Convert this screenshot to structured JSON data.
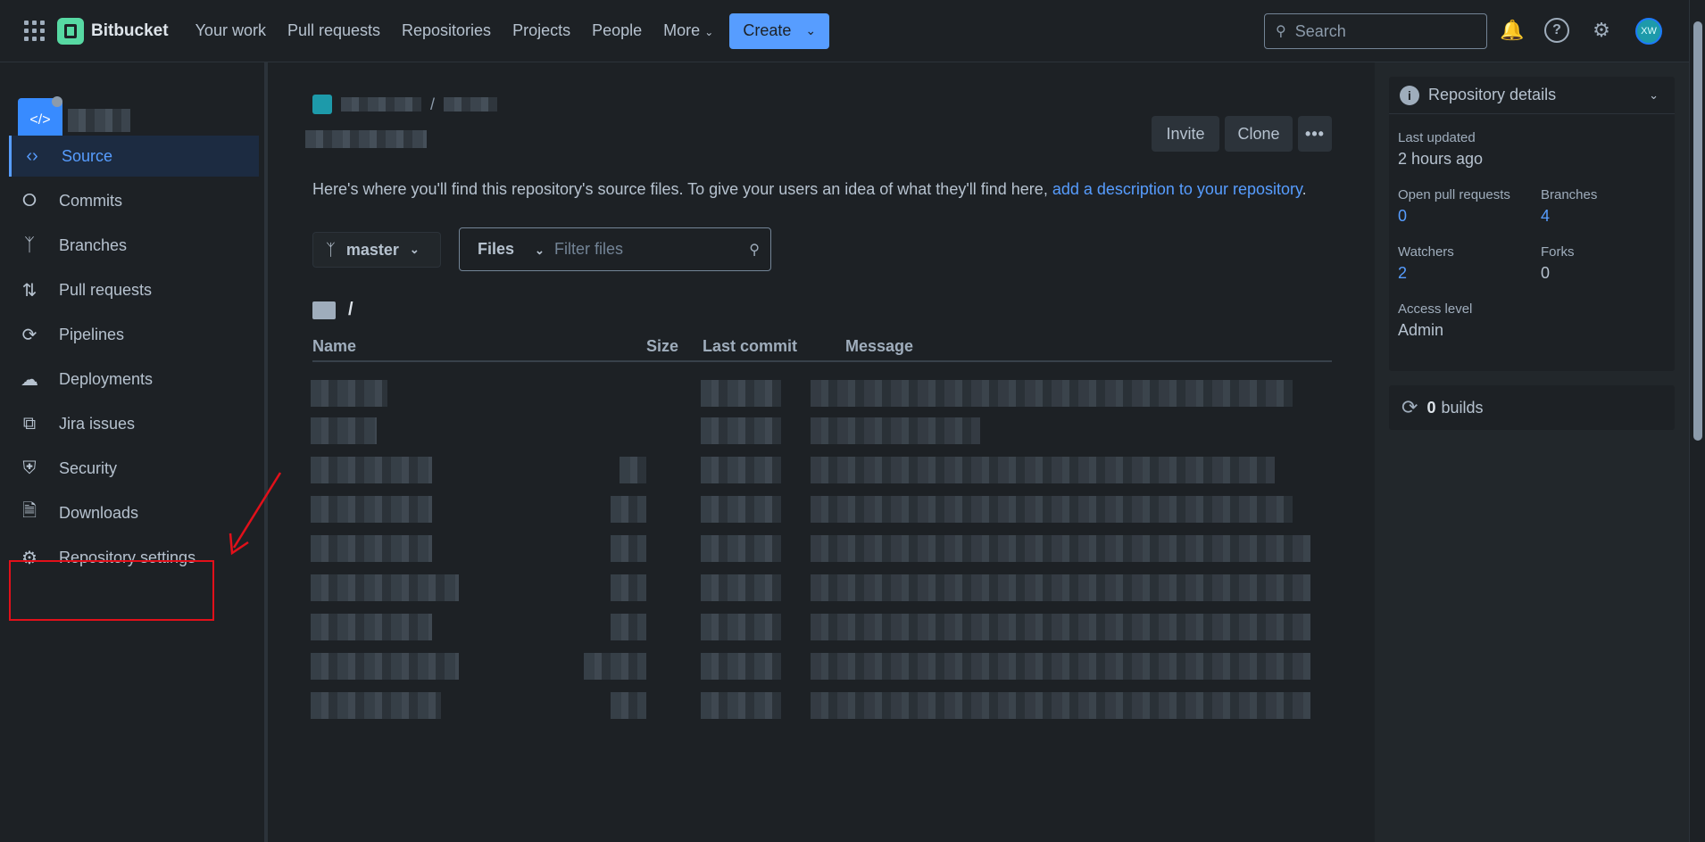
{
  "topbar": {
    "brand": "Bitbucket",
    "nav": [
      "Your work",
      "Pull requests",
      "Repositories",
      "Projects",
      "People",
      "More"
    ],
    "create_label": "Create",
    "search_placeholder": "Search",
    "avatar_initials": "XW"
  },
  "sidebar": {
    "items": [
      {
        "label": "Source",
        "icon": "code-icon"
      },
      {
        "label": "Commits",
        "icon": "commit-icon"
      },
      {
        "label": "Branches",
        "icon": "branch-icon"
      },
      {
        "label": "Pull requests",
        "icon": "pull-request-icon"
      },
      {
        "label": "Pipelines",
        "icon": "pipelines-icon"
      },
      {
        "label": "Deployments",
        "icon": "cloud-upload-icon"
      },
      {
        "label": "Jira issues",
        "icon": "jira-icon"
      },
      {
        "label": "Security",
        "icon": "shield-icon"
      },
      {
        "label": "Downloads",
        "icon": "document-icon"
      },
      {
        "label": "Repository settings",
        "icon": "gear-icon"
      }
    ],
    "active": "Source"
  },
  "main": {
    "invite_label": "Invite",
    "clone_label": "Clone",
    "description_text": "Here's where you'll find this repository's source files. To give your users an idea of what they'll find here, ",
    "description_link": "add a description to your repository",
    "description_end": ".",
    "branch": "master",
    "files_label": "Files",
    "filter_placeholder": "Filter files",
    "path": "/",
    "columns": {
      "name": "Name",
      "size": "Size",
      "last_commit": "Last commit",
      "message": "Message"
    }
  },
  "details": {
    "title": "Repository details",
    "last_updated_label": "Last updated",
    "last_updated": "2 hours ago",
    "open_prs_label": "Open pull requests",
    "open_prs": "0",
    "branches_label": "Branches",
    "branches": "4",
    "watchers_label": "Watchers",
    "watchers": "2",
    "forks_label": "Forks",
    "forks": "0",
    "access_label": "Access level",
    "access": "Admin"
  },
  "builds": {
    "count": "0",
    "label": "builds"
  },
  "colors": {
    "accent": "#579dff",
    "annotation": "#e2101a",
    "background": "#1d2125"
  }
}
